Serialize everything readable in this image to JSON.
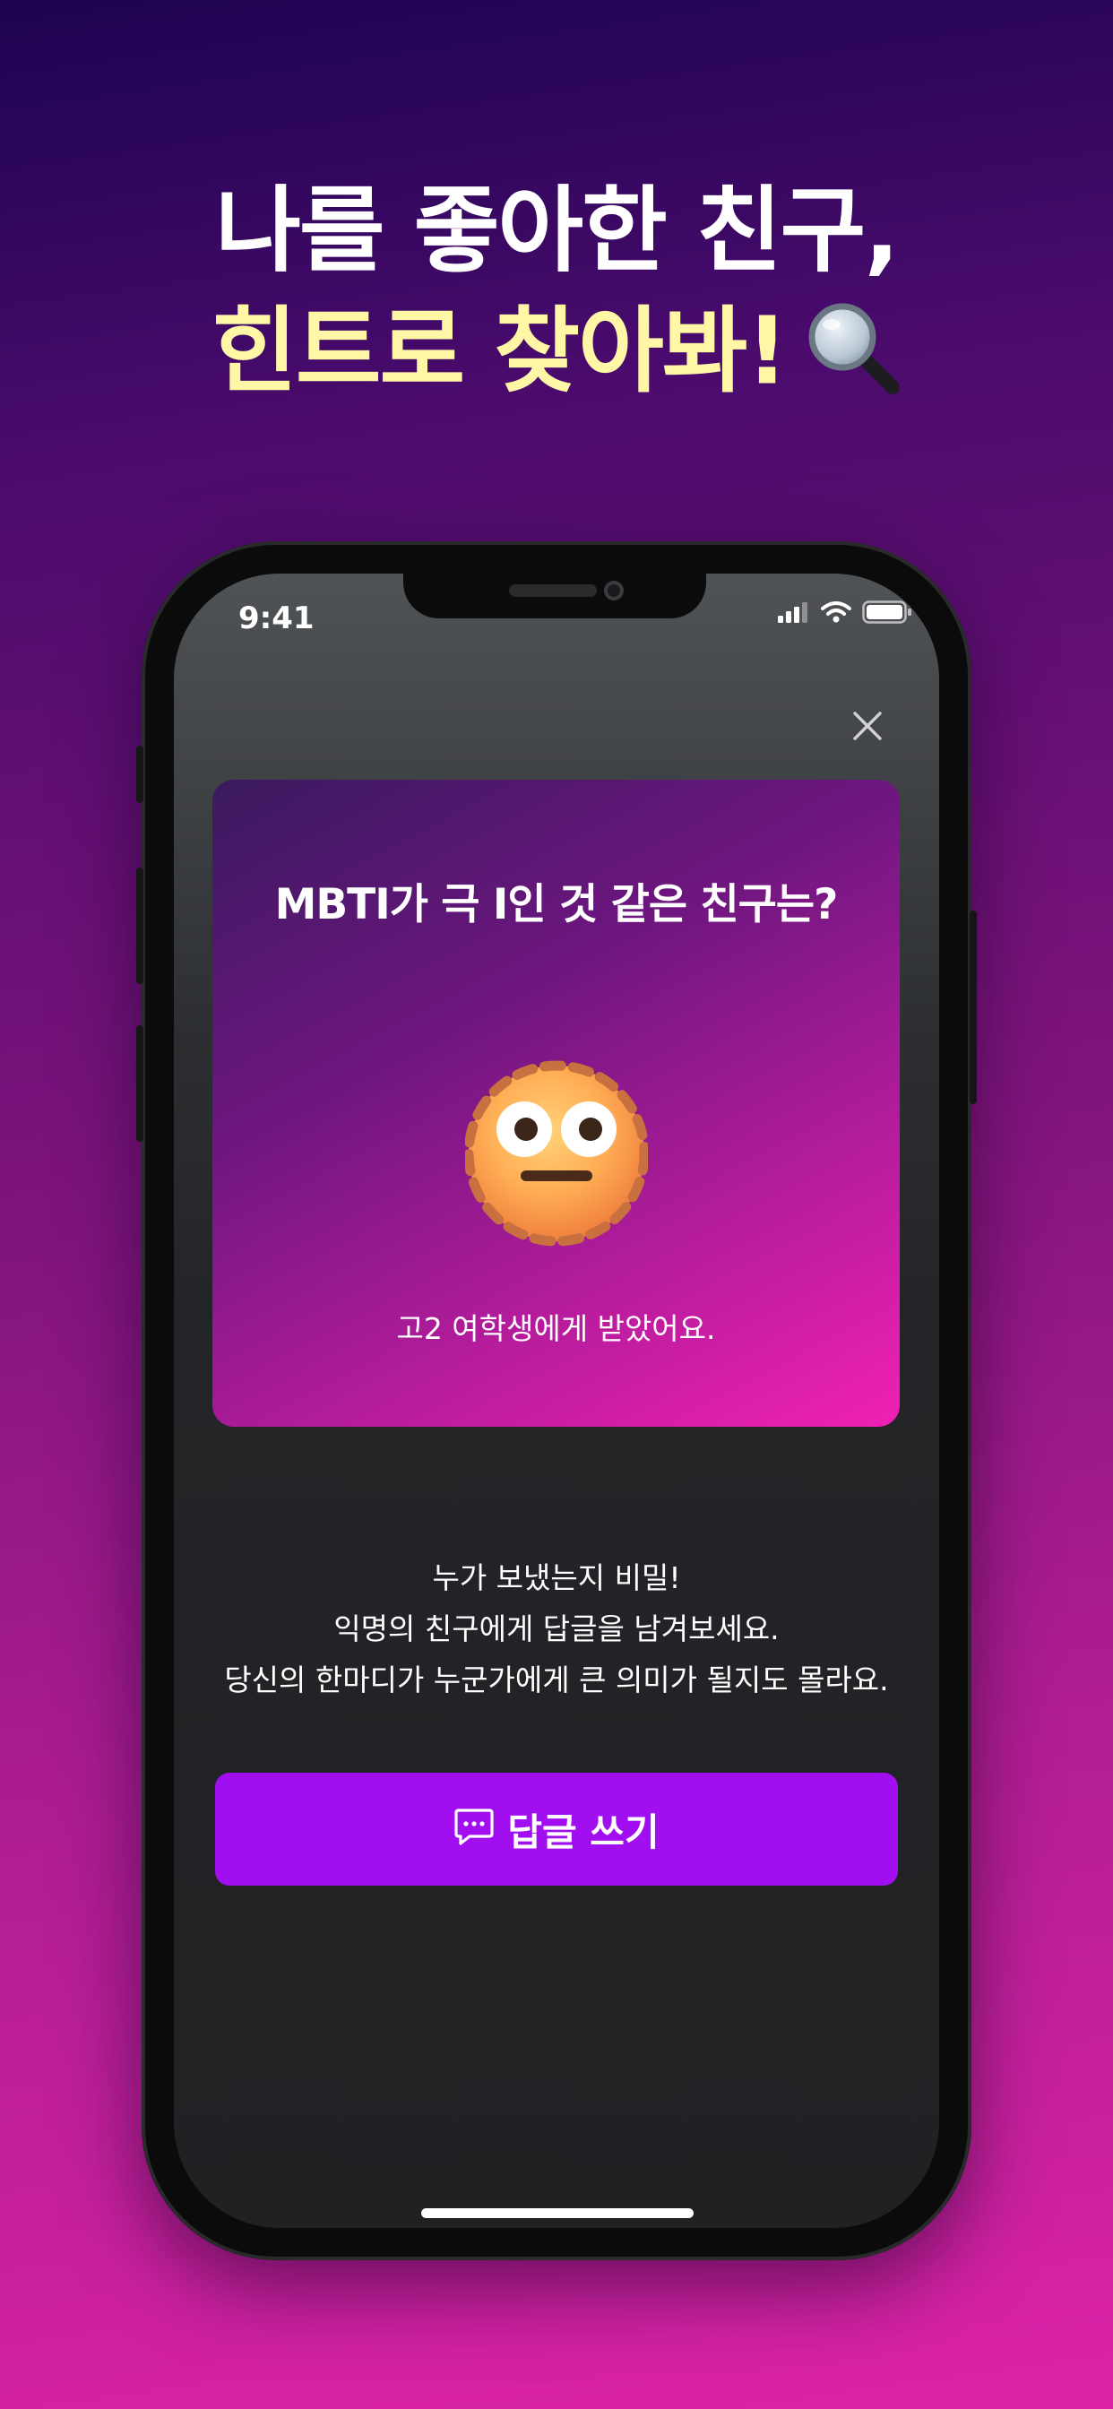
{
  "headline": {
    "line1": "나를 좋아한 친구,",
    "line2": "힌트로 찾아봐!",
    "icon": "magnifying-glass-icon"
  },
  "status_bar": {
    "time": "9:41",
    "icons": [
      "cellular-signal-icon",
      "wifi-icon",
      "battery-icon"
    ]
  },
  "card": {
    "question": "MBTI가 극 I인 것 같은 친구는?",
    "emoji": "neutral-dotted-face-emoji",
    "from": "고2 여학생에게 받았어요."
  },
  "body": {
    "lines": [
      "누가 보냈는지 비밀!",
      "익명의 친구에게 답글을 남겨보세요.",
      "당신의 한마디가 누군가에게 큰 의미가 될지도 몰라요."
    ]
  },
  "reply_button": {
    "label": "답글 쓰기",
    "icon": "message-bubble-icon"
  },
  "colors": {
    "accent": "#a10ff0",
    "headline_highlight": "#fff7a6",
    "card_gradient_start": "#3a1a5f",
    "card_gradient_end": "#f020b4"
  }
}
